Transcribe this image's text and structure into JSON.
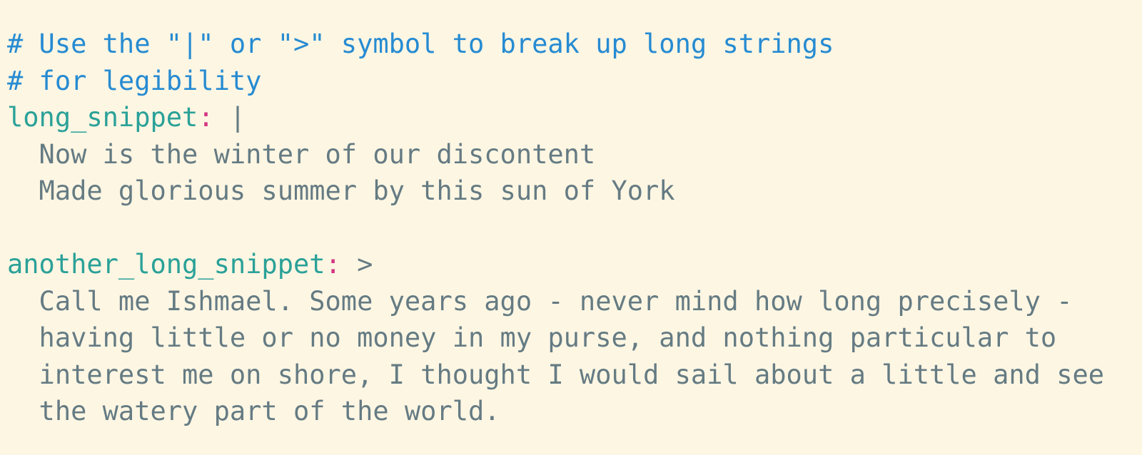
{
  "colors": {
    "background": "#fdf6e3",
    "comment": "#268bd2",
    "key": "#2aa198",
    "colon": "#d33682",
    "text": "#657b83"
  },
  "lines": [
    [
      {
        "cls": "comment",
        "text": "# Use the \"|\" or \">\" symbol to break up long strings"
      }
    ],
    [
      {
        "cls": "comment",
        "text": "# for legibility"
      }
    ],
    [
      {
        "cls": "key",
        "text": "long_snippet"
      },
      {
        "cls": "colon",
        "text": ":"
      },
      {
        "cls": "text",
        "text": " |"
      }
    ],
    [
      {
        "cls": "text",
        "text": "  Now is the winter of our discontent"
      }
    ],
    [
      {
        "cls": "text",
        "text": "  Made glorious summer by this sun of York"
      }
    ],
    [],
    [
      {
        "cls": "key",
        "text": "another_long_snippet"
      },
      {
        "cls": "colon",
        "text": ":"
      },
      {
        "cls": "text",
        "text": " >"
      }
    ],
    [
      {
        "cls": "text",
        "text": "  Call me Ishmael. Some years ago - never mind how long precisely -"
      }
    ],
    [
      {
        "cls": "text",
        "text": "  having little or no money in my purse, and nothing particular to"
      }
    ],
    [
      {
        "cls": "text",
        "text": "  interest me on shore, I thought I would sail about a little and see"
      }
    ],
    [
      {
        "cls": "text",
        "text": "  the watery part of the world."
      }
    ]
  ]
}
